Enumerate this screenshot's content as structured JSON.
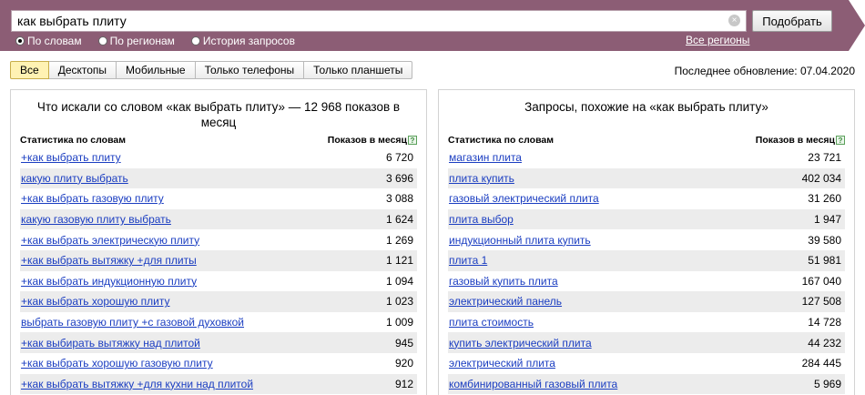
{
  "search": {
    "query": "как выбрать плиту",
    "submit_label": "Подобрать",
    "clear_symbol": "×"
  },
  "modes": [
    {
      "label": "По словам",
      "selected": true
    },
    {
      "label": "По регионам",
      "selected": false
    },
    {
      "label": "История запросов",
      "selected": false
    }
  ],
  "regions_link": "Все регионы",
  "device_tabs": [
    {
      "label": "Все",
      "active": true
    },
    {
      "label": "Десктопы",
      "active": false
    },
    {
      "label": "Мобильные",
      "active": false
    },
    {
      "label": "Только телефоны",
      "active": false
    },
    {
      "label": "Только планшеты",
      "active": false
    }
  ],
  "last_update": "Последнее обновление: 07.04.2020",
  "left_panel": {
    "title": "Что искали со словом «как выбрать плиту» — 12 968 показов в месяц",
    "col_phrase": "Статистика по словам",
    "col_count": "Показов в месяц",
    "help_symbol": "?",
    "rows": [
      {
        "phrase": "+как выбрать плиту",
        "count": "6 720"
      },
      {
        "phrase": "какую плиту выбрать",
        "count": "3 696"
      },
      {
        "phrase": "+как выбрать газовую плиту",
        "count": "3 088"
      },
      {
        "phrase": "какую газовую плиту выбрать",
        "count": "1 624"
      },
      {
        "phrase": "+как выбрать электрическую плиту",
        "count": "1 269"
      },
      {
        "phrase": "+как выбрать вытяжку +для плиты",
        "count": "1 121"
      },
      {
        "phrase": "+как выбрать индукционную плиту",
        "count": "1 094"
      },
      {
        "phrase": "+как выбрать хорошую плиту",
        "count": "1 023"
      },
      {
        "phrase": "выбрать газовую плиту +с газовой духовкой",
        "count": "1 009"
      },
      {
        "phrase": "+как выбирать вытяжку над плитой",
        "count": "945"
      },
      {
        "phrase": "+как выбрать хорошую газовую плиту",
        "count": "920"
      },
      {
        "phrase": "+как выбрать вытяжку +для кухни над плитой",
        "count": "912"
      }
    ]
  },
  "right_panel": {
    "title": "Запросы, похожие на «как выбрать плиту»",
    "col_phrase": "Статистика по словам",
    "col_count": "Показов в месяц",
    "help_symbol": "?",
    "rows": [
      {
        "phrase": "магазин плита",
        "count": "23 721"
      },
      {
        "phrase": "плита купить",
        "count": "402 034"
      },
      {
        "phrase": "газовый электрический плита",
        "count": "31 260"
      },
      {
        "phrase": "плита выбор",
        "count": "1 947"
      },
      {
        "phrase": "индукционный плита купить",
        "count": "39 580"
      },
      {
        "phrase": "плита 1",
        "count": "51 981"
      },
      {
        "phrase": "газовый купить плита",
        "count": "167 040"
      },
      {
        "phrase": "электрический панель",
        "count": "127 508"
      },
      {
        "phrase": "плита стоимость",
        "count": "14 728"
      },
      {
        "phrase": "купить электрический плита",
        "count": "44 232"
      },
      {
        "phrase": "электрический плита",
        "count": "284 445"
      },
      {
        "phrase": "комбинированный газовый плита",
        "count": "5 969"
      }
    ]
  }
}
